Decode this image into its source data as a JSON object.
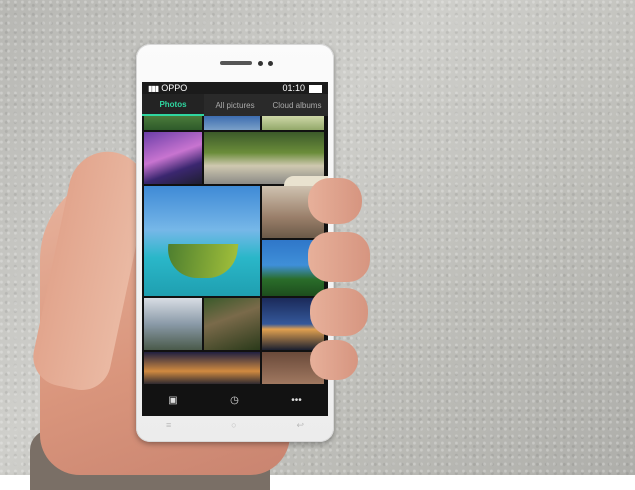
{
  "status_bar": {
    "carrier": "OPPO",
    "time": "01:10"
  },
  "tabs": [
    {
      "label": "Photos",
      "active": true
    },
    {
      "label": "All pictures",
      "active": false
    },
    {
      "label": "Cloud albums",
      "active": false
    }
  ],
  "bottom_bar": {
    "camera_icon": "camera-icon",
    "timeline_icon": "clock-icon",
    "more_icon": "more-icon"
  },
  "nav_keys": {
    "menu_icon": "menu-icon",
    "home_icon": "home-icon",
    "back_icon": "back-icon"
  },
  "colors": {
    "accent": "#2fd6a0"
  }
}
